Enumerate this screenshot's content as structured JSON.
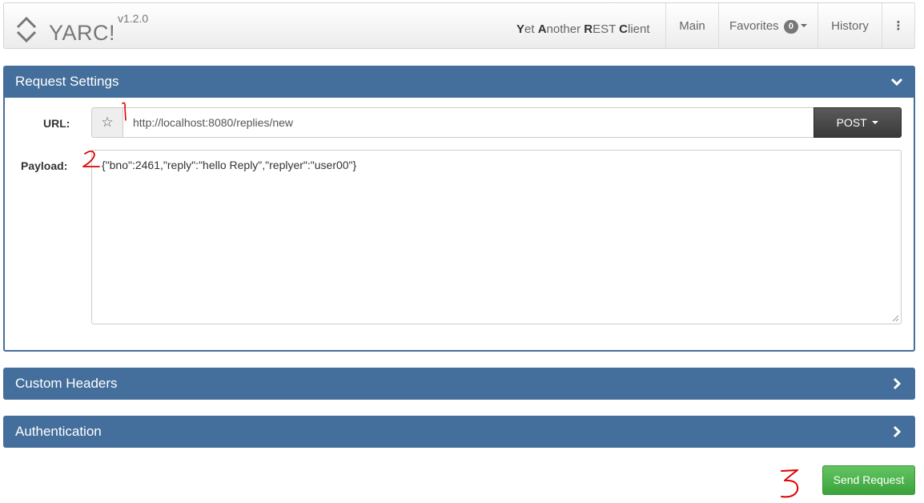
{
  "app": {
    "name": "YARC!",
    "version": "v1.2.0",
    "tagline": [
      {
        "b": "Y",
        "t": "et "
      },
      {
        "b": "A",
        "t": "nother "
      },
      {
        "b": "R",
        "t": "EST "
      },
      {
        "b": "C",
        "t": "lient"
      }
    ]
  },
  "nav": {
    "main": "Main",
    "favorites": "Favorites",
    "favorites_count": "0",
    "history": "History",
    "more": "⋮"
  },
  "panels": {
    "request_settings": "Request Settings",
    "custom_headers": "Custom Headers",
    "authentication": "Authentication"
  },
  "request": {
    "url_label": "URL:",
    "url_value": "http://localhost:8080/replies/new",
    "method": "POST",
    "payload_label": "Payload:",
    "payload_value": "{\"bno\":2461,\"reply\":\"hello Reply\",\"replyer\":\"user00\"}"
  },
  "actions": {
    "send": "Send Request"
  },
  "colors": {
    "panel_header": "#446e9b",
    "send_button": "#47b347",
    "method_button": "#444444",
    "annotation": "#e00000"
  },
  "icons": [
    "yarc-logo-icon",
    "chevron-down-icon",
    "chevron-right-icon",
    "star-icon",
    "caret-down-icon",
    "resize-grip-icon"
  ]
}
